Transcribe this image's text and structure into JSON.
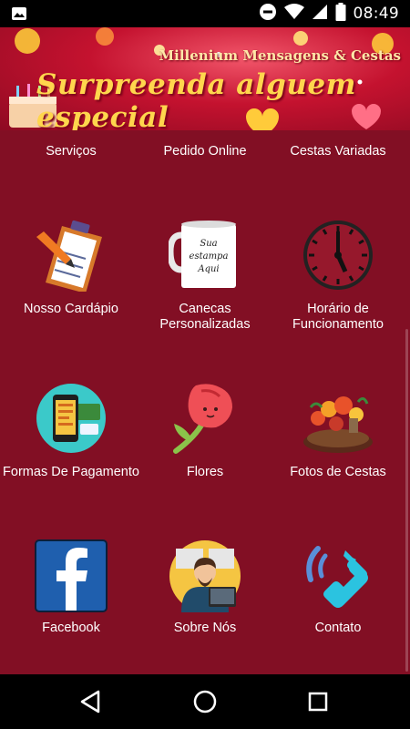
{
  "status_bar": {
    "time": "08:49",
    "icons": [
      "image-icon",
      "do-not-disturb-icon",
      "wifi-icon",
      "signal-icon",
      "battery-icon"
    ]
  },
  "banner": {
    "subtitle": "Millenium Mensagens & Cestas",
    "headline": "Surpreenda alguem especial"
  },
  "menu": {
    "row0": [
      "Serviços",
      "Pedido Online",
      "Cestas Variadas"
    ],
    "items": [
      {
        "label": "Nosso Cardápio",
        "icon": "clipboard-icon"
      },
      {
        "label": "Canecas Personalizadas",
        "icon": "mug-icon",
        "mug_text": "Sua estampa Aqui"
      },
      {
        "label": "Horário de Funcionamento",
        "icon": "clock-icon"
      },
      {
        "label": "Formas De Pagamento",
        "icon": "payment-phone-icon"
      },
      {
        "label": "Flores",
        "icon": "rose-icon"
      },
      {
        "label": "Fotos de Cestas",
        "icon": "basket-icon"
      },
      {
        "label": "Facebook",
        "icon": "facebook-icon"
      },
      {
        "label": "Sobre Nós",
        "icon": "person-at-computer-icon"
      },
      {
        "label": "Contato",
        "icon": "phone-icon"
      }
    ]
  },
  "colors": {
    "background": "#820f24",
    "banner": "#c4122f",
    "text": "#ffffff",
    "facebook": "#1f5fae",
    "contact": "#2bc3e0"
  },
  "nav": {
    "buttons": [
      "back-icon",
      "home-icon",
      "recents-icon"
    ]
  }
}
